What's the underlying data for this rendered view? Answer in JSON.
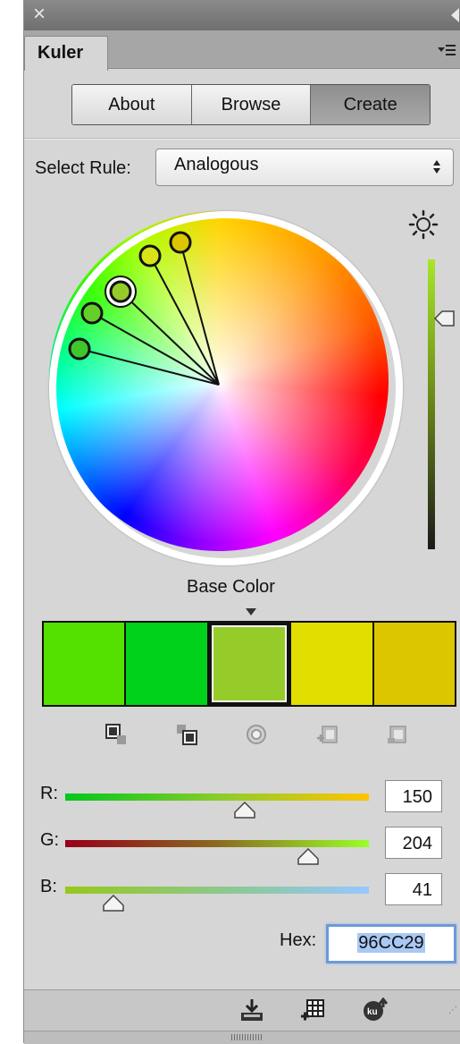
{
  "window": {
    "close_icon": "close-icon",
    "collapse_icon": "collapse-arrow-icon"
  },
  "tabs": {
    "active_tab": "Kuler",
    "menu_icon": "panel-menu-icon"
  },
  "segmented": [
    {
      "label": "About",
      "active": false
    },
    {
      "label": "Browse",
      "active": false
    },
    {
      "label": "Create",
      "active": true
    }
  ],
  "rule": {
    "label": "Select Rule:",
    "selected": "Analogous"
  },
  "wheel": {
    "brightness_icon": "brightness-icon"
  },
  "base_color": {
    "label": "Base Color",
    "selected_index": 2
  },
  "swatches": [
    {
      "hex": "#55E100"
    },
    {
      "hex": "#00D11A"
    },
    {
      "hex": "#96CC29"
    },
    {
      "hex": "#E2DE00"
    },
    {
      "hex": "#DCC600"
    }
  ],
  "action_icons": [
    "copy-to-left-icon",
    "copy-to-right-icon",
    "target-icon",
    "add-swatch-icon",
    "remove-swatch-icon"
  ],
  "sliders": {
    "r": {
      "label": "R:",
      "value": "150",
      "fraction": 0.59
    },
    "g": {
      "label": "G:",
      "value": "204",
      "fraction": 0.8
    },
    "b": {
      "label": "B:",
      "value": "41",
      "fraction": 0.16
    }
  },
  "hex": {
    "label": "Hex:",
    "value": "96CC29"
  },
  "footer_icons": [
    "add-to-swatches-icon",
    "add-to-library-icon",
    "upload-to-kuler-icon"
  ]
}
